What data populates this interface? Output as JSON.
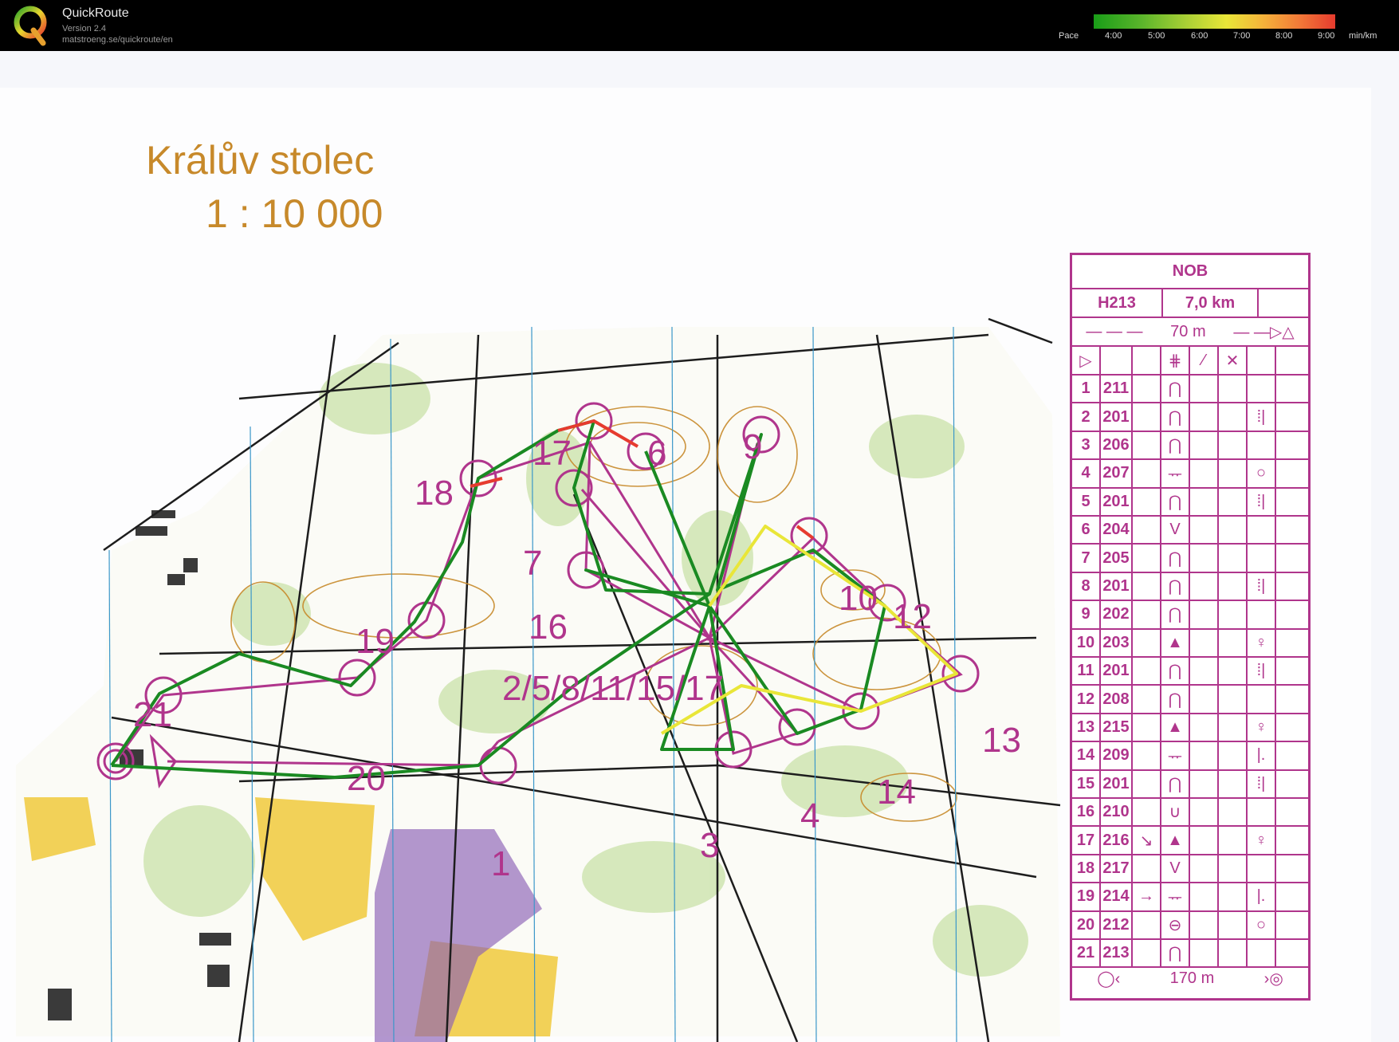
{
  "app": {
    "title": "QuickRoute",
    "version": "Version 2.4",
    "url": "matstroeng.se/quickroute/en",
    "logo_letter": "Q"
  },
  "pace_legend": {
    "label": "Pace",
    "ticks": [
      "4:00",
      "5:00",
      "6:00",
      "7:00",
      "8:00",
      "9:00"
    ],
    "unit": "min/km"
  },
  "map": {
    "title": "Králův stolec",
    "scale": "1 : 10 000",
    "control_numbers": [
      "1",
      "2/5/8/11/15/17",
      "3",
      "4",
      "6",
      "7",
      "9",
      "10",
      "12",
      "13",
      "14",
      "16",
      "17",
      "18",
      "19",
      "20",
      "21"
    ],
    "colors": {
      "course": "#b0358c",
      "route_fast": "#1a8a22",
      "route_slow": "#e63b2e",
      "contour": "#c7892a"
    }
  },
  "description_sheet": {
    "event": "NOB",
    "class": "H213",
    "length": "7,0 km",
    "start_marking": "70 m",
    "finish_marking": "170 m",
    "rows": [
      {
        "n": "1",
        "code": "211",
        "feature": "⋂",
        "extra": ""
      },
      {
        "n": "2",
        "code": "201",
        "feature": "⋂",
        "extra": "⁞|"
      },
      {
        "n": "3",
        "code": "206",
        "feature": "⋂",
        "extra": ""
      },
      {
        "n": "4",
        "code": "207",
        "feature": "ᅲ",
        "extra": "○"
      },
      {
        "n": "5",
        "code": "201",
        "feature": "⋂",
        "extra": "⁞|"
      },
      {
        "n": "6",
        "code": "204",
        "feature": "V",
        "extra": ""
      },
      {
        "n": "7",
        "code": "205",
        "feature": "⋂",
        "extra": ""
      },
      {
        "n": "8",
        "code": "201",
        "feature": "⋂",
        "extra": "⁞|"
      },
      {
        "n": "9",
        "code": "202",
        "feature": "⋂",
        "extra": ""
      },
      {
        "n": "10",
        "code": "203",
        "feature": "▲",
        "extra": "♀"
      },
      {
        "n": "11",
        "code": "201",
        "feature": "⋂",
        "extra": "⁞|"
      },
      {
        "n": "12",
        "code": "208",
        "feature": "⋂",
        "extra": ""
      },
      {
        "n": "13",
        "code": "215",
        "feature": "▲",
        "extra": "♀"
      },
      {
        "n": "14",
        "code": "209",
        "feature": "ᅲ",
        "extra": "|."
      },
      {
        "n": "15",
        "code": "201",
        "feature": "⋂",
        "extra": "⁞|"
      },
      {
        "n": "16",
        "code": "210",
        "feature": "∪",
        "extra": ""
      },
      {
        "n": "17",
        "code": "216",
        "feature": "▲",
        "extra": "♀",
        "dir": "↘"
      },
      {
        "n": "18",
        "code": "217",
        "feature": "V",
        "extra": ""
      },
      {
        "n": "19",
        "code": "214",
        "feature": "ᅲ",
        "extra": "|.",
        "dir": "→"
      },
      {
        "n": "20",
        "code": "212",
        "feature": "⊖",
        "extra": "○"
      },
      {
        "n": "21",
        "code": "213",
        "feature": "⋂",
        "extra": ""
      }
    ]
  }
}
